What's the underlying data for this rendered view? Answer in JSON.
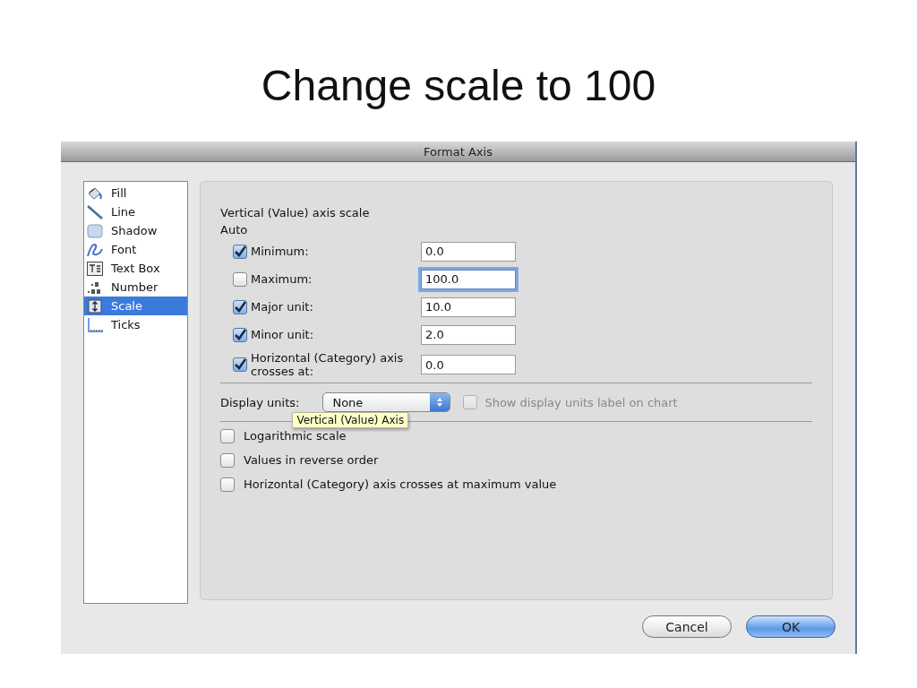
{
  "slide_title": "Change scale to 100",
  "dialog": {
    "title": "Format Axis",
    "sidebar": {
      "items": [
        {
          "label": "Fill",
          "selected": false
        },
        {
          "label": "Line",
          "selected": false
        },
        {
          "label": "Shadow",
          "selected": false
        },
        {
          "label": "Font",
          "selected": false
        },
        {
          "label": "Text Box",
          "selected": false
        },
        {
          "label": "Number",
          "selected": false
        },
        {
          "label": "Scale",
          "selected": true
        },
        {
          "label": "Ticks",
          "selected": false
        }
      ]
    },
    "section_title": "Vertical (Value) axis scale",
    "auto_label": "Auto",
    "fields": [
      {
        "label": "Minimum:",
        "checked": true,
        "value": "0.0",
        "focused": false
      },
      {
        "label": "Maximum:",
        "checked": false,
        "value": "100.0",
        "focused": true
      },
      {
        "label": "Major unit:",
        "checked": true,
        "value": "10.0",
        "focused": false
      },
      {
        "label": "Minor unit:",
        "checked": true,
        "value": "2.0",
        "focused": false
      },
      {
        "label": "Horizontal (Category) axis crosses at:",
        "checked": true,
        "value": "0.0",
        "focused": false
      }
    ],
    "display_units": {
      "label": "Display units:",
      "value": "None"
    },
    "units_label_option": {
      "label": "Show display units label on chart",
      "checked": false,
      "disabled": true
    },
    "tooltip": "Vertical (Value) Axis",
    "options": [
      {
        "label": "Logarithmic scale",
        "checked": false
      },
      {
        "label": "Values in reverse order",
        "checked": false
      },
      {
        "label": "Horizontal (Category) axis crosses at maximum value",
        "checked": false
      }
    ],
    "buttons": [
      {
        "label": "Cancel",
        "default": false
      },
      {
        "label": "OK",
        "default": true
      }
    ]
  }
}
